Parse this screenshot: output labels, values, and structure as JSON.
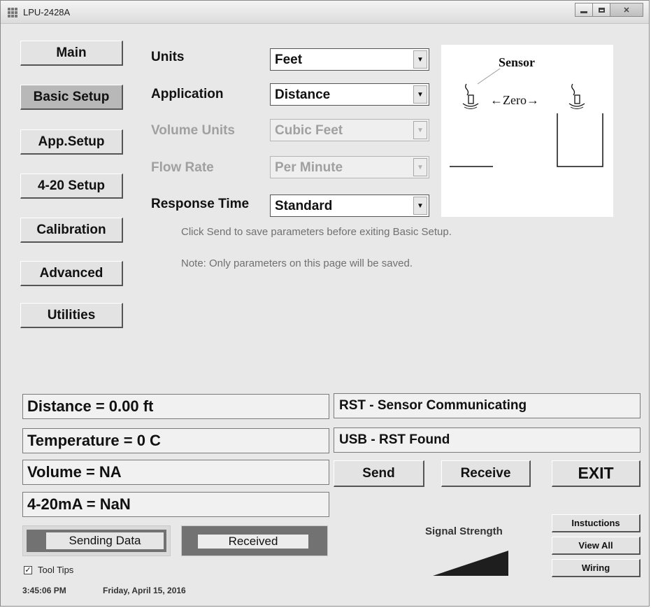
{
  "window": {
    "title": "LPU-2428A"
  },
  "nav": [
    "Main",
    "Basic Setup",
    "App.Setup",
    "4-20 Setup",
    "Calibration",
    "Advanced",
    "Utilities"
  ],
  "form": {
    "units": {
      "label": "Units",
      "value": "Feet"
    },
    "application": {
      "label": "Application",
      "value": "Distance"
    },
    "volume_units": {
      "label": "Volume Units",
      "value": "Cubic Feet"
    },
    "flow_rate": {
      "label": "Flow Rate",
      "value": "Per Minute"
    },
    "response_time": {
      "label": "Response Time",
      "value": "Standard"
    }
  },
  "diagram": {
    "sensor_label": "Sensor",
    "zero_label": "←Zero→"
  },
  "notes": {
    "send_note": "Click Send  to save parameters before exiting Basic Setup.",
    "only_note": "Note: Only parameters on this page will be saved."
  },
  "readouts": {
    "distance": "Distance = 0.00 ft",
    "temperature": "Temperature = 0 C",
    "volume": "Volume = NA",
    "current": "4-20mA = NaN"
  },
  "status": {
    "sensor": "RST - Sensor Communicating",
    "usb": "USB - RST Found"
  },
  "buttons": {
    "send": "Send",
    "receive": "Receive",
    "exit": "EXIT",
    "instructions": "Instuctions",
    "view_all": "View All",
    "wiring": "Wiring"
  },
  "indicators": {
    "sending": "Sending Data",
    "received": "Received"
  },
  "signal": {
    "label": "Signal Strength"
  },
  "tooltips": {
    "label": "Tool Tips",
    "checked": true
  },
  "footer": {
    "time": "3:45:06 PM",
    "date": "Friday, April 15, 2016"
  }
}
